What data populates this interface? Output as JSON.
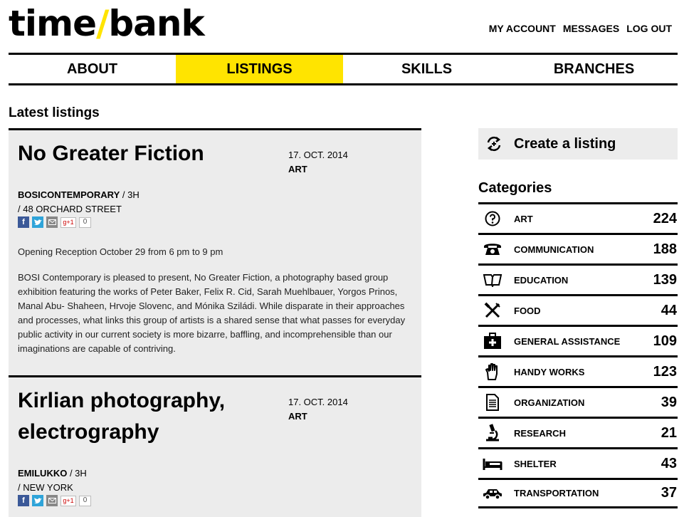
{
  "header": {
    "logo_part1": "time",
    "logo_slash": "/",
    "logo_part2": "bank",
    "account_links": [
      "MY ACCOUNT",
      "MESSAGES",
      "LOG OUT"
    ]
  },
  "nav": {
    "items": [
      "ABOUT",
      "LISTINGS",
      "SKILLS",
      "BRANCHES"
    ],
    "active": "LISTINGS",
    "accent_color": "#ffe400"
  },
  "listings_section": {
    "title": "Latest listings",
    "items": [
      {
        "title": "No Greater Fiction",
        "date": "17. OCT. 2014",
        "category": "ART",
        "author": "BOSICONTEMPORARY",
        "age": " / 3H",
        "location": "/ 48 ORCHARD STREET",
        "share_count": "0",
        "paragraphs": [
          "Opening Reception October 29 from 6 pm to 9 pm",
          "BOSI Contemporary is pleased to present, No Greater Fiction, a photography based group exhibition featuring the works of Peter Baker, Felix R. Cid, Sarah Muehlbauer, Yorgos Prinos, Manal Abu- Shaheen, Hrvoje Slovenc, and Mónika Sziládi. While disparate in their approaches and processes, what links this group of artists is a shared sense that what passes for everyday public activity in our current society is more bizarre, baffling, and incomprehensible than our imaginations are capable of contriving."
        ]
      },
      {
        "title": "Kirlian photography, electrography",
        "date": "17. OCT. 2014",
        "category": "ART",
        "author": "EMILUKKO",
        "age": " / 3H",
        "location": "/ NEW YORK",
        "share_count": "0",
        "paragraphs": []
      }
    ]
  },
  "sidebar": {
    "create_label": "Create a listing",
    "categories_title": "Categories",
    "categories": [
      {
        "label": "ART",
        "count": "224",
        "icon": "question-icon"
      },
      {
        "label": "COMMUNICATION",
        "count": "188",
        "icon": "telephone-icon"
      },
      {
        "label": "EDUCATION",
        "count": "139",
        "icon": "book-icon"
      },
      {
        "label": "FOOD",
        "count": "44",
        "icon": "fork-knife-icon"
      },
      {
        "label": "GENERAL ASSISTANCE",
        "count": "109",
        "icon": "first-aid-icon"
      },
      {
        "label": "HANDY WORKS",
        "count": "123",
        "icon": "hand-icon"
      },
      {
        "label": "ORGANIZATION",
        "count": "39",
        "icon": "document-icon"
      },
      {
        "label": "RESEARCH",
        "count": "21",
        "icon": "microscope-icon"
      },
      {
        "label": "SHELTER",
        "count": "43",
        "icon": "bed-icon"
      },
      {
        "label": "TRANSPORTATION",
        "count": "37",
        "icon": "car-icon"
      }
    ]
  }
}
